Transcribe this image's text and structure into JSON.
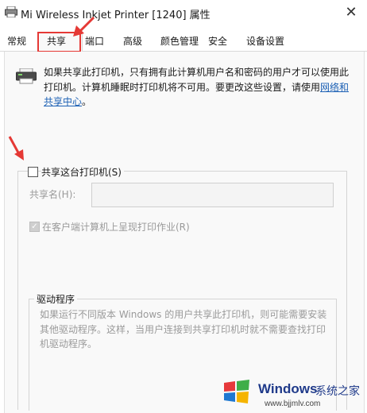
{
  "window": {
    "title": "Mi Wireless Inkjet Printer [1240] 属性",
    "close_glyph": "✕"
  },
  "tabs": [
    {
      "label": "常规"
    },
    {
      "label": "共享"
    },
    {
      "label": "端口"
    },
    {
      "label": "高级"
    },
    {
      "label": "颜色管理"
    },
    {
      "label": "安全"
    },
    {
      "label": "设备设置"
    }
  ],
  "active_tab": "共享",
  "sharing": {
    "description": "如果共享此打印机，只有拥有此计算机用户名和密码的用户才可以使用此打印机。计算机睡眠时打印机将不可用。要更改这些设置，请使用",
    "network_link": "网络和共享中心",
    "description_end": "。",
    "share_checkbox_label": "共享这台打印机(S)",
    "share_checked": false,
    "share_name_label": "共享名(H):",
    "share_name_value": "",
    "render_label": "在客户端计算机上呈现打印作业(R)",
    "render_checked": true,
    "driver_group_title": "驱动程序",
    "driver_description": "如果运行不同版本 Windows 的用户共享此打印机，则可能需要安装其他驱动程序。这样，当用户连接到共享打印机时就不需要查找打印机驱动程序。"
  },
  "watermark": {
    "brand": "Windows",
    "cn": "系统之家",
    "url": "www.bjjmlv.com"
  },
  "colors": {
    "highlight": "#e53935",
    "link": "#1a5fb4",
    "disabled_text": "#9a9a9a"
  }
}
